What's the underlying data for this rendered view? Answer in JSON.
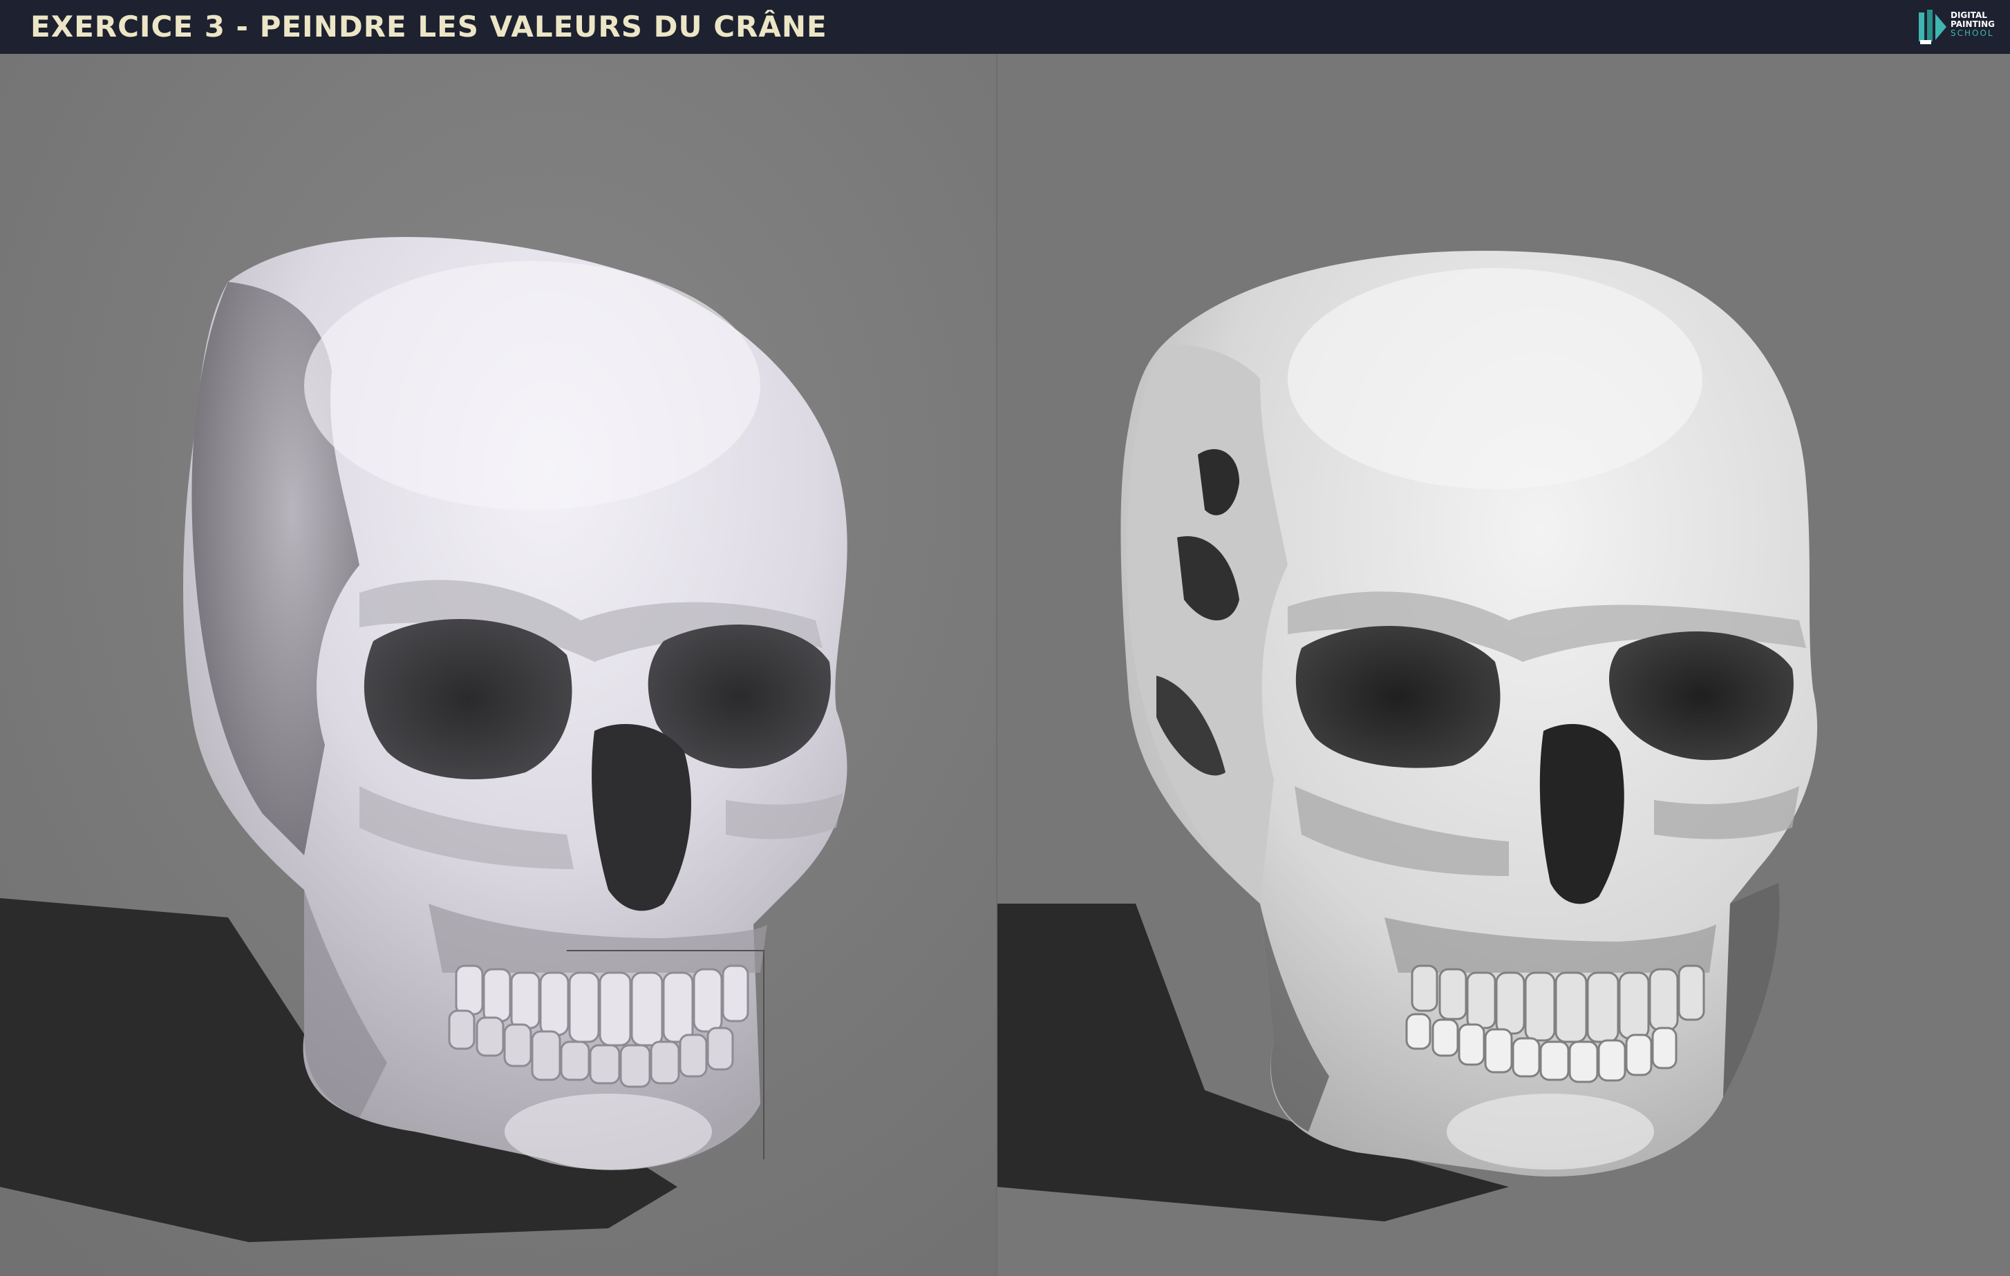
{
  "header": {
    "title": "EXERCICE 3 - PEINDRE LES VALEURS DU CRÂNE",
    "logo_lines": [
      "DIGITAL",
      "PAINTING",
      "SCHOOL"
    ],
    "logo_icon": "brush-pencil-icon"
  },
  "colors": {
    "header_bg": "#1d2130",
    "title_text": "#ece6c6",
    "logo_accent": "#3fb6b0",
    "background_gray": "#787878"
  },
  "panels": [
    {
      "name": "skull-3d-reference",
      "image_subject": "skull-render"
    },
    {
      "name": "skull-painted-study",
      "image_subject": "skull-painting"
    }
  ]
}
